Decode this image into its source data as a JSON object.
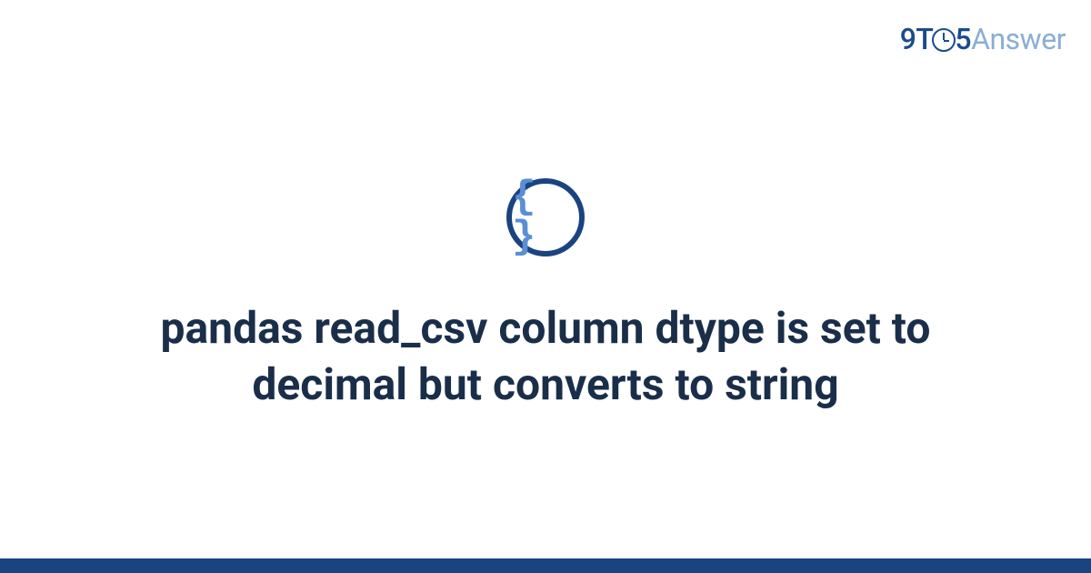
{
  "logo": {
    "part1": "9T",
    "part2": "5",
    "part3": "Answer"
  },
  "icon": {
    "glyph": "{ }",
    "name": "code-braces"
  },
  "title": "pandas read_csv column dtype is set to decimal but converts to string"
}
